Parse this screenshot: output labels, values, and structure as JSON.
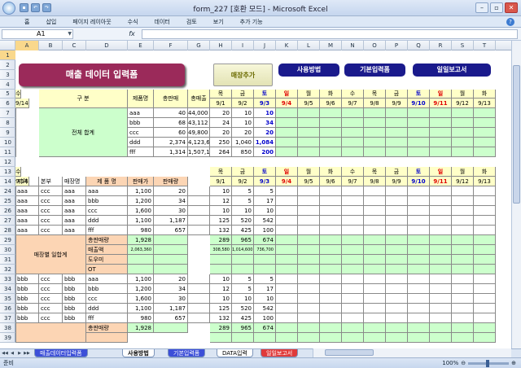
{
  "window": {
    "title": "form_227  [호환 모드]  -  Microsoft Excel",
    "minimize": "–",
    "restore": "▫",
    "close": "✕"
  },
  "ribbon_tabs": [
    "홈",
    "삽입",
    "페이지 레이아웃",
    "수식",
    "데이터",
    "검토",
    "보기",
    "추가 기능"
  ],
  "formula_bar": {
    "name_box": "A1",
    "fx": "fx",
    "value": ""
  },
  "columns": [
    "A",
    "B",
    "C",
    "D",
    "E",
    "F",
    "G",
    "H",
    "I",
    "J",
    "K",
    "L",
    "M",
    "N",
    "O",
    "P",
    "Q",
    "R",
    "S",
    "T"
  ],
  "rows": [
    "1",
    "2",
    "3",
    "4",
    "5",
    "6",
    "7",
    "8",
    "9",
    "10",
    "11",
    "12",
    "13",
    "14",
    "24",
    "25",
    "26",
    "27",
    "28",
    "29",
    "30",
    "31",
    "32",
    "33",
    "34",
    "35",
    "36",
    "37",
    "38",
    "39"
  ],
  "buttons": {
    "main_title": "매출 데이터 입력폼",
    "add_store": "매장추가",
    "usage": "사용방법",
    "basic_input": "기본입력폼",
    "daily_report": "일일보고서"
  },
  "summary": {
    "category_header": "구  분",
    "product_header": "제품명",
    "qty_header": "총판매",
    "amount_header": "총매출",
    "total_label": "전체 합계",
    "rows": [
      {
        "product": "aaa",
        "qty": "40",
        "amount": "44,000",
        "v": [
          "20",
          "10",
          "10"
        ]
      },
      {
        "product": "bbb",
        "qty": "68",
        "amount": "43,112",
        "v": [
          "24",
          "10",
          "34"
        ]
      },
      {
        "product": "ccc",
        "qty": "60",
        "amount": "49,800",
        "v": [
          "20",
          "20",
          "20"
        ]
      },
      {
        "product": "ddd",
        "qty": "2,374",
        "amount": "4,123,638",
        "v": [
          "250",
          "1,040",
          "1,084"
        ]
      },
      {
        "product": "fff",
        "qty": "1,314",
        "amount": "1,507,158",
        "v": [
          "264",
          "850",
          "200"
        ]
      }
    ]
  },
  "days": [
    "목",
    "금",
    "토",
    "일",
    "월",
    "화",
    "수",
    "목",
    "금",
    "토",
    "일",
    "월",
    "화",
    "수"
  ],
  "dates": [
    "9/1",
    "9/2",
    "9/3",
    "9/4",
    "9/5",
    "9/6",
    "9/7",
    "9/8",
    "9/9",
    "9/10",
    "9/11",
    "9/12",
    "9/13",
    "9/14"
  ],
  "detail": {
    "headers": {
      "region": "지역",
      "hq": "본부",
      "store": "매장명",
      "product": "제 품 명",
      "unit_price": "판매가",
      "sold": "판매량"
    },
    "store_summary_label": "매장별 일합계",
    "summary_labels": [
      "총판매량",
      "매출액",
      "도우미",
      "OT"
    ],
    "groups": [
      {
        "rows": [
          {
            "region": "aaa",
            "hq": "ccc",
            "store": "aaa",
            "product": "aaa",
            "price": "1,100",
            "sold": "20",
            "v": [
              "10",
              "5",
              "5"
            ]
          },
          {
            "region": "aaa",
            "hq": "ccc",
            "store": "aaa",
            "product": "bbb",
            "price": "1,200",
            "sold": "34",
            "v": [
              "12",
              "5",
              "17"
            ]
          },
          {
            "region": "aaa",
            "hq": "ccc",
            "store": "aaa",
            "product": "ccc",
            "price": "1,600",
            "sold": "30",
            "v": [
              "10",
              "10",
              "10"
            ]
          },
          {
            "region": "aaa",
            "hq": "ccc",
            "store": "aaa",
            "product": "ddd",
            "price": "1,100",
            "sold": "1,187",
            "v": [
              "125",
              "520",
              "542"
            ]
          },
          {
            "region": "aaa",
            "hq": "ccc",
            "store": "aaa",
            "product": "fff",
            "price": "980",
            "sold": "657",
            "v": [
              "132",
              "425",
              "100"
            ]
          }
        ],
        "total_qty": "1,928",
        "total_v": [
          "289",
          "965",
          "674"
        ],
        "sales_amount": "2,063,360",
        "sales_v": [
          "308,580",
          "1,014,600",
          "736,700"
        ]
      },
      {
        "rows": [
          {
            "region": "bbb",
            "hq": "ccc",
            "store": "bbb",
            "product": "aaa",
            "price": "1,100",
            "sold": "20",
            "v": [
              "10",
              "5",
              "5"
            ]
          },
          {
            "region": "bbb",
            "hq": "ccc",
            "store": "bbb",
            "product": "bbb",
            "price": "1,200",
            "sold": "34",
            "v": [
              "12",
              "5",
              "17"
            ]
          },
          {
            "region": "bbb",
            "hq": "ccc",
            "store": "bbb",
            "product": "ccc",
            "price": "1,600",
            "sold": "30",
            "v": [
              "10",
              "10",
              "10"
            ]
          },
          {
            "region": "bbb",
            "hq": "ccc",
            "store": "bbb",
            "product": "ddd",
            "price": "1,100",
            "sold": "1,187",
            "v": [
              "125",
              "520",
              "542"
            ]
          },
          {
            "region": "bbb",
            "hq": "ccc",
            "store": "bbb",
            "product": "fff",
            "price": "980",
            "sold": "657",
            "v": [
              "132",
              "425",
              "100"
            ]
          }
        ],
        "total_qty": "1,928",
        "total_v": [
          "289",
          "965",
          "674"
        ]
      }
    ]
  },
  "sheet_tabs": [
    "매출데이터입력폼",
    "사용방법",
    "기본입력폼",
    "DATA입력",
    "일일보고서"
  ],
  "active_sheet": "사용방법",
  "status": {
    "ready": "준비",
    "zoom": "100%"
  },
  "colors": {
    "title_button": "#9b2a5a",
    "blue_button": "#1a1a8c",
    "header_yellow": "#ffffc8",
    "total_green": "#ccffcc",
    "detail_orange": "#fcd5b4"
  }
}
